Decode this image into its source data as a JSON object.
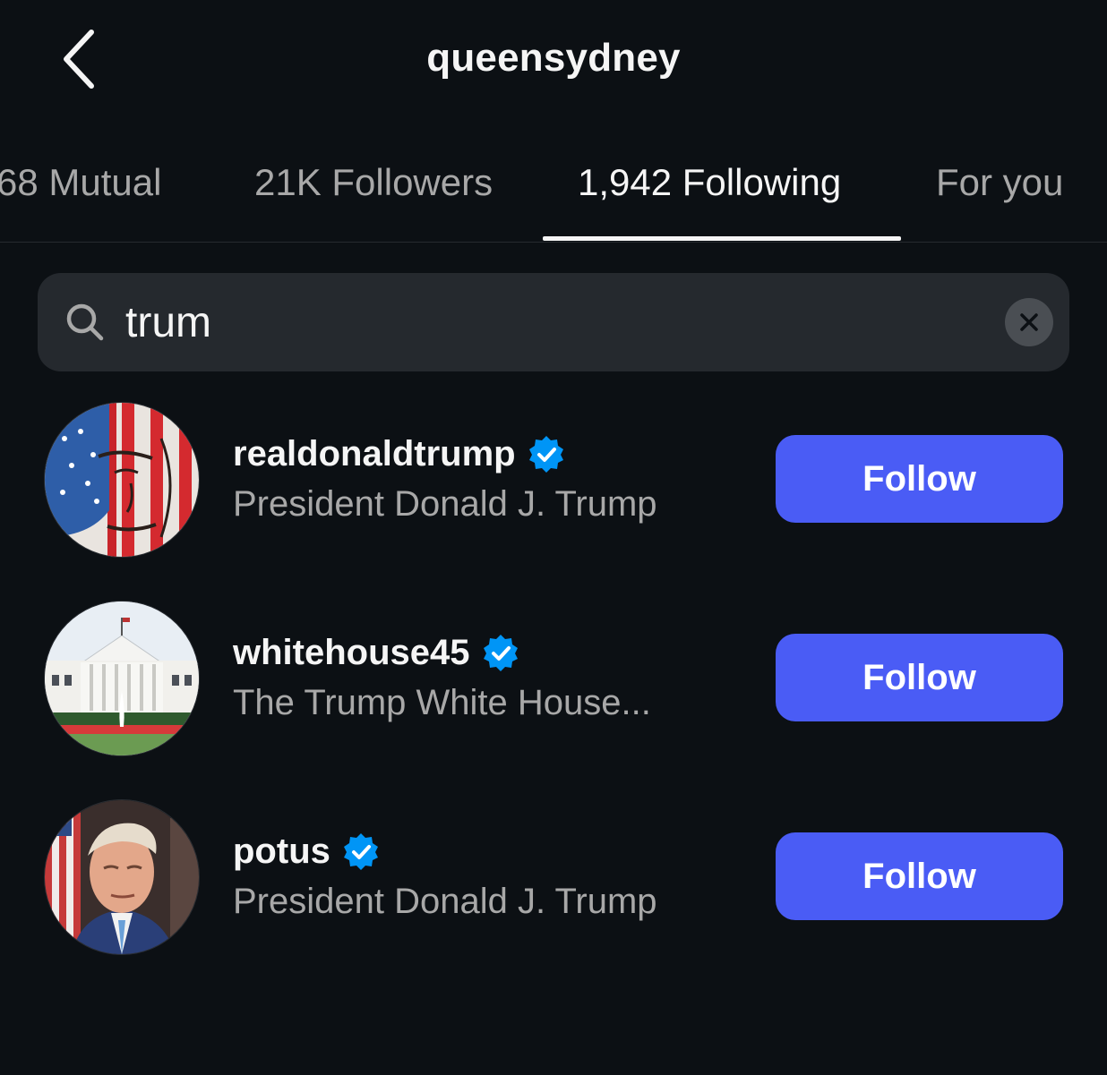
{
  "header": {
    "title": "queensydney",
    "back_icon": "chevron-left-icon"
  },
  "tabs": [
    {
      "label": "68 Mutual",
      "active": false
    },
    {
      "label": "21K Followers",
      "active": false
    },
    {
      "label": "1,942 Following",
      "active": true
    },
    {
      "label": "For you",
      "active": false
    }
  ],
  "search": {
    "icon": "search-icon",
    "value": "trum",
    "clear_icon": "close-icon"
  },
  "results": [
    {
      "username": "realdonaldtrump",
      "full_name": "President Donald J. Trump",
      "verified": true,
      "button_label": "Follow"
    },
    {
      "username": "whitehouse45",
      "full_name": "The Trump White House...",
      "verified": true,
      "button_label": "Follow"
    },
    {
      "username": "potus",
      "full_name": "President Donald J. Trump",
      "verified": true,
      "button_label": "Follow"
    }
  ],
  "colors": {
    "background": "#0c1014",
    "follow_button": "#4a5cf5",
    "verified_badge": "#0095f6",
    "search_bg": "#25292e",
    "muted_text": "#a8a8a8"
  }
}
